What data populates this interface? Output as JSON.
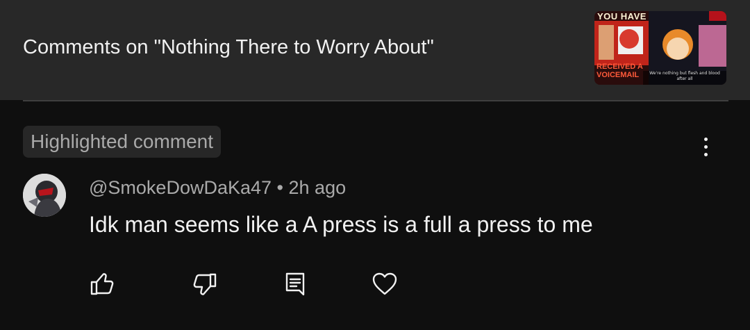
{
  "header": {
    "title": "Comments on \"Nothing There to Worry About\"",
    "thumbnail": {
      "text_top": "YOU HAVE",
      "text_bottom_1": "RECEIVED A",
      "text_bottom_2": "VOICEMAIL",
      "caption_1": "We're nothing but flesh and blood",
      "caption_2": "after all"
    }
  },
  "comment": {
    "badge": "Highlighted comment",
    "author": "@SmokeDowDaKa47",
    "separator": "•",
    "time": "2h ago",
    "text": "Idk man seems like a A press is a full a press to me"
  },
  "actions": [
    {
      "icon": "thumbs-up-icon"
    },
    {
      "icon": "thumbs-down-icon"
    },
    {
      "icon": "reply-icon"
    },
    {
      "icon": "heart-icon"
    }
  ],
  "colors": {
    "background": "#0f0f0f",
    "header_background": "#282828",
    "primary_text": "#f1f1f1",
    "secondary_text": "#aaaaaa",
    "badge_background": "#272727"
  }
}
